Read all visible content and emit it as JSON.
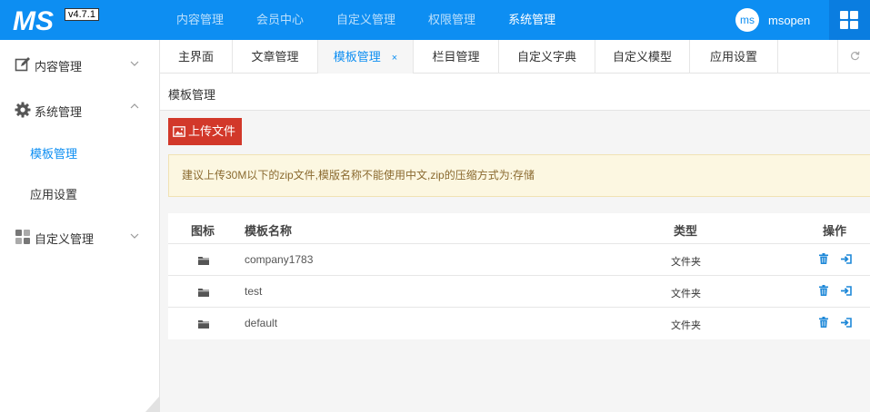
{
  "header": {
    "logo_text": "MS",
    "version": "v4.7.1",
    "nav": [
      "内容管理",
      "会员中心",
      "自定义管理",
      "权限管理",
      "系统管理"
    ],
    "active_nav_index": 4,
    "user": {
      "avatar_text": "ms",
      "name": "msopen"
    },
    "apps_icon": "grid-icon"
  },
  "sidebar": {
    "menus": [
      {
        "label": "内容管理",
        "icon": "edit-icon",
        "expanded": false
      },
      {
        "label": "系统管理",
        "icon": "gear-icon",
        "expanded": true
      },
      {
        "label": "自定义管理",
        "icon": "modules-icon",
        "expanded": false
      }
    ],
    "sub_items": [
      {
        "label": "模板管理",
        "active": true
      },
      {
        "label": "应用设置",
        "active": false
      }
    ]
  },
  "tabs": {
    "items": [
      "主界面",
      "文章管理",
      "模板管理",
      "栏目管理",
      "自定义字典",
      "自定义模型",
      "应用设置"
    ],
    "active_index": 2,
    "close_glyph": "×",
    "refresh_icon": "refresh-icon"
  },
  "page": {
    "title": "模板管理",
    "upload_label": "上传文件",
    "notice": "建议上传30M以下的zip文件,模版名称不能使用中文,zip的压缩方式为:存储"
  },
  "table": {
    "columns": [
      "图标",
      "模板名称",
      "类型",
      "操作"
    ],
    "rows": [
      {
        "icon": "folder-icon",
        "name": "company1783",
        "type": "文件夹"
      },
      {
        "icon": "folder-icon",
        "name": "test",
        "type": "文件夹"
      },
      {
        "icon": "folder-icon",
        "name": "default",
        "type": "文件夹"
      }
    ]
  },
  "colors": {
    "primary": "#0d8ef2",
    "upload_button": "#d2382a",
    "notice_bg": "#fcf7e1",
    "notice_text": "#8a6a2f"
  }
}
